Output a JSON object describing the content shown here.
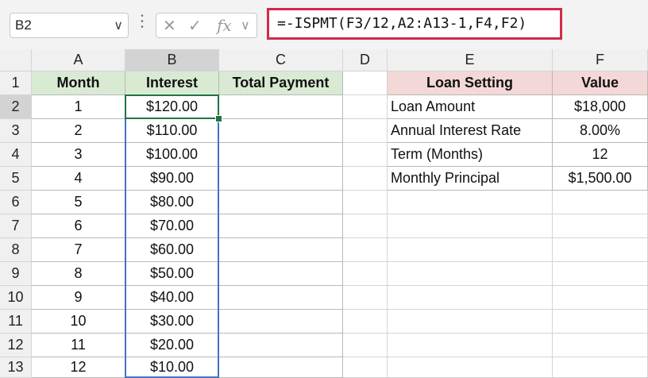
{
  "name_box": "B2",
  "formula": "=-ISPMT(F3/12,A2:A13-1,F4,F2)",
  "columns": [
    "A",
    "B",
    "C",
    "D",
    "E",
    "F"
  ],
  "rows": [
    "1",
    "2",
    "3",
    "4",
    "5",
    "6",
    "7",
    "8",
    "9",
    "10",
    "11",
    "12",
    "13"
  ],
  "table1": {
    "headers": [
      "Month",
      "Interest",
      "Total Payment"
    ],
    "rows": [
      [
        "1",
        "$120.00",
        ""
      ],
      [
        "2",
        "$110.00",
        ""
      ],
      [
        "3",
        "$100.00",
        ""
      ],
      [
        "4",
        "$90.00",
        ""
      ],
      [
        "5",
        "$80.00",
        ""
      ],
      [
        "6",
        "$70.00",
        ""
      ],
      [
        "7",
        "$60.00",
        ""
      ],
      [
        "8",
        "$50.00",
        ""
      ],
      [
        "9",
        "$40.00",
        ""
      ],
      [
        "10",
        "$30.00",
        ""
      ],
      [
        "11",
        "$20.00",
        ""
      ],
      [
        "12",
        "$10.00",
        ""
      ]
    ]
  },
  "table2": {
    "headers": [
      "Loan Setting",
      "Value"
    ],
    "rows": [
      [
        "Loan Amount",
        "$18,000"
      ],
      [
        "Annual Interest Rate",
        "8.00%"
      ],
      [
        "Term (Months)",
        "12"
      ],
      [
        "Monthly Principal",
        "$1,500.00"
      ]
    ]
  },
  "colors": {
    "formula_highlight": "#d12a4a",
    "selection": "#217346",
    "range": "#4472c4",
    "header_green": "#d9ead3",
    "header_pink": "#f4d7d7"
  }
}
